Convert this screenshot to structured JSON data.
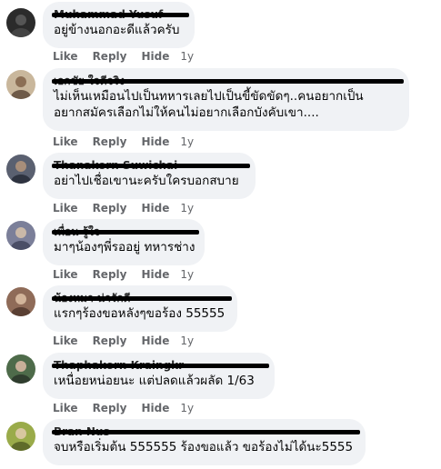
{
  "actions": {
    "like": "Like",
    "reply": "Reply",
    "hide": "Hide"
  },
  "comments": [
    {
      "name": "Muhammad Yusuf",
      "text": [
        "อยู่ข้างนอกอะดีแล้วครับ"
      ],
      "time": "1y",
      "avatar_color": "#2a2a2a"
    },
    {
      "name": "เอกชัย ใจดีจริง",
      "text": [
        "ไม่เห็นเหมือนไปเป็นทหารเลยไปเป็นขี้ขัดขัดๆ..คนอยากเป็น",
        "อยากสมัครเลือกไม่ให้คนไม่อยากเลือกบังคับเขา...."
      ],
      "time": "1y",
      "avatar_color": "#b9a58a"
    },
    {
      "name": "Thanakorn Suwichai",
      "text": [
        "อย่าไปเชื่อเขานะครับใครบอกสบาย"
      ],
      "time": "1y",
      "avatar_color": "#4a4f5a"
    },
    {
      "name": "เพื่อน รู้ใจ",
      "text": [
        "มาๆน้องๆพี่รออยู่ ทหารช่าง"
      ],
      "time": "1y",
      "avatar_color": "#6c6f86"
    },
    {
      "name": "น้องหมา น่ารักดี",
      "text": [
        "แรกๆร้องขอหลังๆขอร้อง 55555"
      ],
      "time": "1y",
      "avatar_color": "#7d5a4a"
    },
    {
      "name": "Thaphakorn Kraingkr",
      "text": [
        "เหนื่อยหน่อยนะ แต่ปลดแล้วผลัด 1/63"
      ],
      "time": "1y",
      "avatar_color": "#3d5a3a"
    },
    {
      "name": "Bran Nus",
      "text": [
        "จบหรือเริ่มต้น 555555 ร้องขอแล้ว ขอร้องไม่ได้นะ5555"
      ],
      "time": "1y",
      "avatar_color": "#8a9a3a"
    }
  ]
}
